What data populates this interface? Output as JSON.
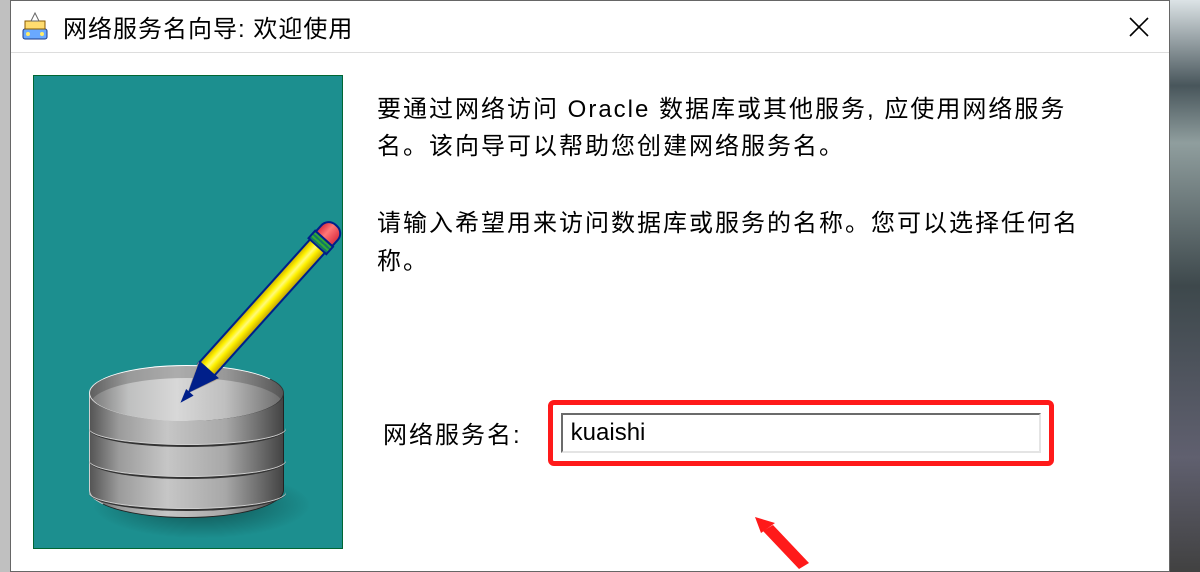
{
  "title": "网络服务名向导: 欢迎使用",
  "paragraphs": {
    "intro": "要通过网络访问 Oracle 数据库或其他服务, 应使用网络服务名。该向导可以帮助您创建网络服务名。",
    "prompt": "请输入希望用来访问数据库或服务的名称。您可以选择任何名称。"
  },
  "form": {
    "label": "网络服务名:",
    "value": "kuaishi"
  },
  "icons": {
    "close": "close-icon",
    "wizard": "wizard-icon",
    "pencil": "pencil-icon",
    "database": "database-cylinder-icon",
    "annotation_arrow": "red-arrow-icon"
  },
  "colors": {
    "highlight_box": "#ff1a1a",
    "side_bg": "#1c8f8f"
  }
}
